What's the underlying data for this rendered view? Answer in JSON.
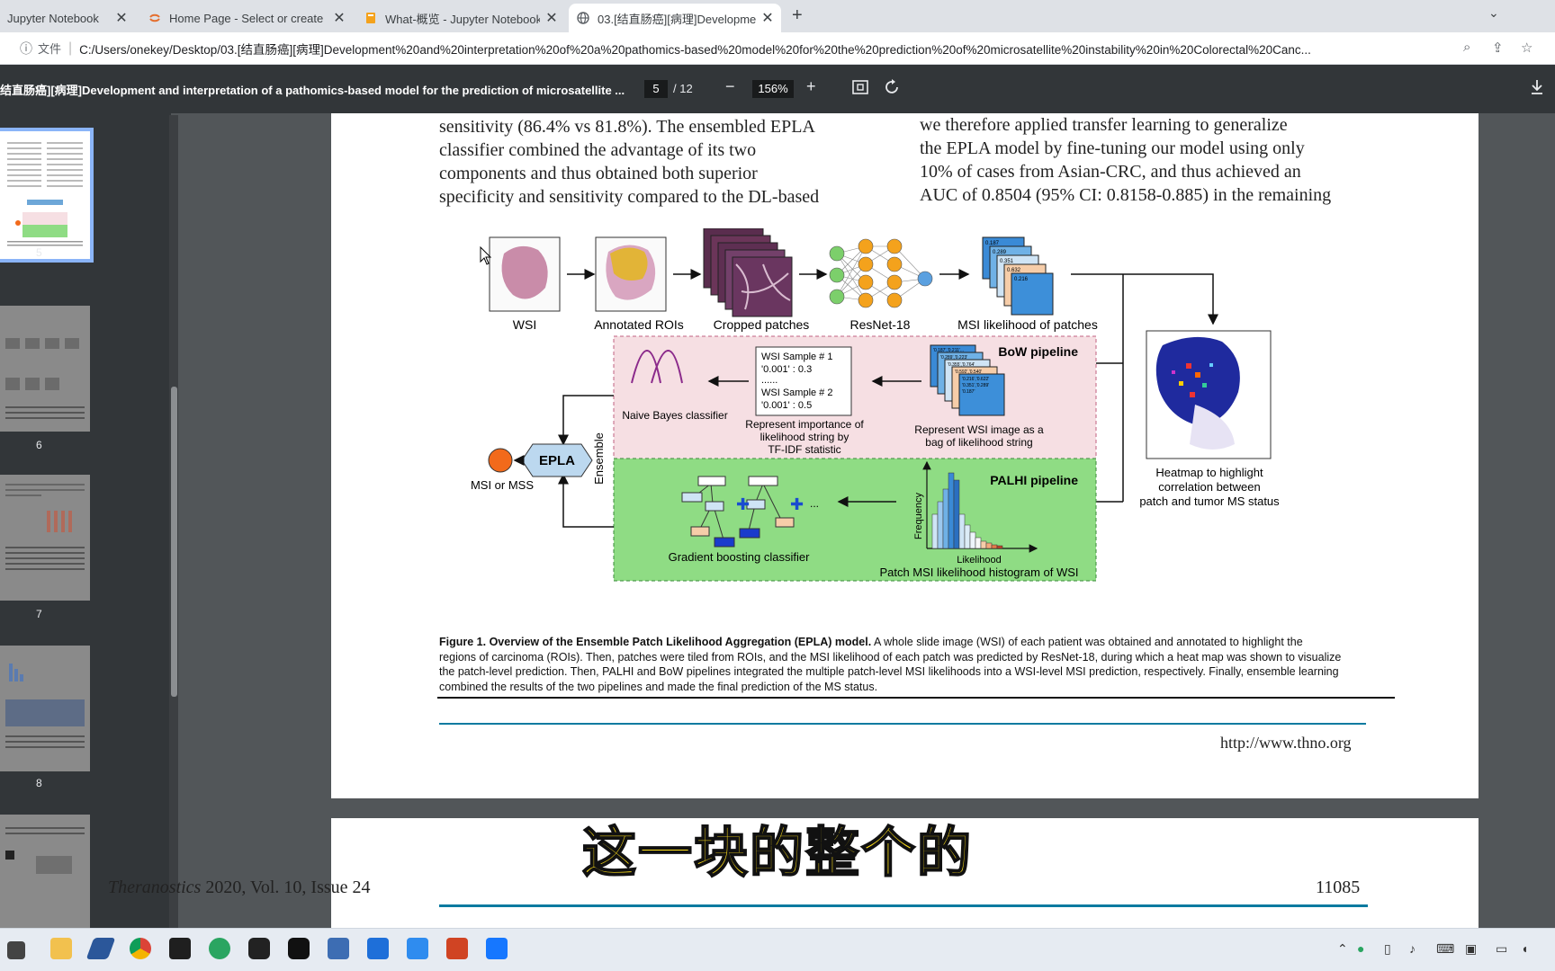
{
  "browser": {
    "tabs": [
      {
        "title": "Jupyter Notebook",
        "icon": "jupyter-icon"
      },
      {
        "title": "Home Page - Select or create",
        "icon": "jupyter-icon"
      },
      {
        "title": "What-概览 - Jupyter Notebook",
        "icon": "notebook-icon"
      },
      {
        "title": "03.[结直肠癌][病理]Developme",
        "icon": "globe-icon",
        "active": true
      }
    ],
    "new_tab": "+",
    "address": {
      "label": "文件",
      "url": "C:/Users/onekey/Desktop/03.[结直肠癌][病理]Development%20and%20interpretation%20of%20a%20pathomics-based%20model%20for%20the%20prediction%20of%20microsatellite%20instability%20in%20Colorectal%20Canc..."
    }
  },
  "pdf": {
    "title": "结直肠癌][病理]Development and interpretation of a pathomics-based model for the prediction of microsatellite ...",
    "page": "5",
    "total": "/ 12",
    "zoom": "156%",
    "thumbs": [
      "5",
      "6",
      "7",
      "8"
    ]
  },
  "page": {
    "left_col": [
      "sensitivity (86.4% vs 81.8%). The ensembled EPLA",
      "classifier combined the advantage of its two",
      "components and thus obtained both superior",
      "specificity and sensitivity compared to the DL-based"
    ],
    "right_col": [
      "we therefore applied transfer learning to generalize",
      "the EPLA model by fine-tuning our model using only",
      "10% of cases from Asian-CRC, and thus achieved an",
      "AUC of 0.8504 (95% CI: 0.8158-0.885) in the remaining"
    ],
    "figure": {
      "wsi": "WSI",
      "rois": "Annotated ROIs",
      "patches": "Cropped patches",
      "resnet": "ResNet-18",
      "msi_patches": "MSI likelihood of patches",
      "patch_vals": [
        "0.187",
        "0.289",
        "0.351",
        "0.632",
        "0.216"
      ],
      "bow_title": "BoW pipeline",
      "palhi_title": "PALHI pipeline",
      "wsi_sample1": "WSI Sample # 1",
      "val1": "'0.001' : 0.3",
      "dots": "......",
      "wsi_sample2": "WSI Sample # 2",
      "val2": "'0.001' : 0.5",
      "bow_strings": [
        "'0.187','0.211'...",
        "'0.289','0.223'",
        "'0.355','0.764'",
        "'0.592','0.540'",
        "'0.216','0.622'",
        "'0.351','0.289'",
        "'0.187'"
      ],
      "tfidf": [
        "Represent importance of",
        "likelihood string by",
        "TF-IDF statistic"
      ],
      "bag": [
        "Represent WSI image as a",
        "bag of likelihood string"
      ],
      "naive": "Naive Bayes classifier",
      "epla": "EPLA",
      "ensemble": "Ensemble",
      "msi_mss": "MSI or MSS",
      "gbc": "Gradient boosting classifier",
      "freq": "Frequency",
      "likelihood": "Likelihood",
      "hist": "Patch MSI likelihood histogram of WSI",
      "heatmap": [
        "Heatmap to highlight",
        "correlation between",
        "patch and tumor MS status"
      ],
      "ellipsis": "..."
    },
    "caption_bold": "Figure 1. Overview of the Ensemble Patch Likelihood Aggregation (EPLA) model.",
    "caption_first": " A whole slide image (WSI) of each patient was obtained and annotated to highlight the",
    "caption_lines": [
      "regions of carcinoma (ROIs). Then, patches were tiled from ROIs, and the MSI likelihood of each patch was predicted by ResNet-18, during which a heat map was shown to visualize",
      "the patch-level prediction. Then, PALHI and BoW pipelines integrated the multiple patch-level MSI likelihoods into a WSI-level MSI prediction, respectively. Finally, ensemble learning",
      "combined the results of the two pipelines and made the final prediction of the MS status."
    ],
    "url": "http://www.thno.org",
    "journal_italic": "Theranostics",
    "journal_rest": " 2020, Vol. 10, Issue 24",
    "page_number": "11085"
  },
  "subtitle": "这一块的整个的",
  "colors": {
    "bow_bg": "#f6dfe3",
    "palhi_bg": "#8fdc84",
    "node": "#f4a21c",
    "node_green": "#7ccf6b",
    "node_blue": "#5aa0e0",
    "msi": "#f26a1b",
    "epla": "#bcd8ef"
  }
}
